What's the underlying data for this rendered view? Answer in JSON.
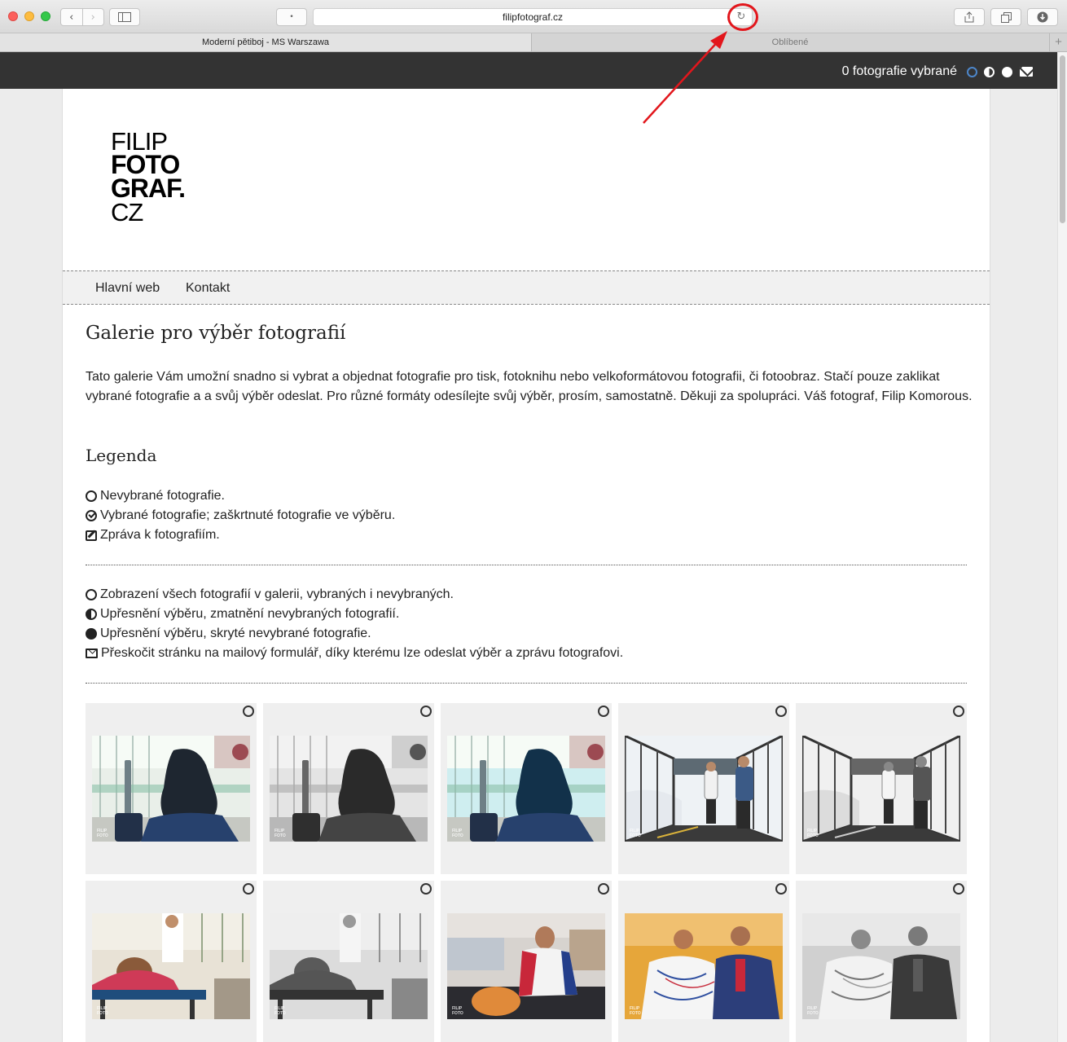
{
  "browser": {
    "url": "filipfotograf.cz",
    "tabs": [
      {
        "label": "Moderní pětiboj - MS Warszawa",
        "active": true
      },
      {
        "label": "Oblíbené",
        "active": false
      }
    ],
    "icons": [
      "back-icon",
      "forward-icon",
      "sidebar-icon",
      "reload-icon",
      "share-icon",
      "tabs-icon",
      "downloads-icon",
      "new-tab-icon"
    ]
  },
  "topbar": {
    "selected_count": "0 fotografie vybrané",
    "icons": [
      "circle-outline-icon",
      "half-circle-icon",
      "full-circle-icon",
      "envelope-icon"
    ],
    "accent_color": "#4d86c9"
  },
  "logo": {
    "line1": "FILIP",
    "line2": "FOTO",
    "line3": "GRAF.",
    "line4": "CZ"
  },
  "menu": {
    "items": [
      {
        "label": "Hlavní web"
      },
      {
        "label": "Kontakt"
      }
    ]
  },
  "content": {
    "title": "Galerie pro výběr fotografií",
    "intro": "Tato galerie Vám umožní snadno si vybrat a objednat fotografie pro tisk, fotoknihu nebo velkoformátovou fotografii, či fotoobraz. Stačí pouze zaklikat vybrané fotografie a a svůj výběr odeslat. Pro různé formáty odesílejte svůj výběr, prosím, samostatně. Děkuji za spolupráci. Váš fotograf, Filip Komorous.",
    "legend_title": "Legenda",
    "legend_items": [
      {
        "icon": "circle-outline-icon",
        "text": "Nevybrané fotografie."
      },
      {
        "icon": "check-circle-icon",
        "text": "Vybrané fotografie; zaškrtnuté fotografie ve výběru."
      },
      {
        "icon": "edit-icon",
        "text": "Zpráva k fotografiím."
      }
    ],
    "view_items": [
      {
        "icon": "circle-outline-icon",
        "text": "Zobrazení všech fotografií v galerii, vybraných i nevybraných."
      },
      {
        "icon": "half-circle-icon",
        "text": "Upřesnění výběru, zmatnění nevybraných fotografií."
      },
      {
        "icon": "full-circle-icon",
        "text": "Upřesnění výběru, skryté nevybrané fotografie."
      },
      {
        "icon": "envelope-icon",
        "text": "Přeskočit stránku na mailový formulář, díky kterému lze odeslat výběr a zprávu fotografovi."
      }
    ]
  },
  "gallery": {
    "watermark": "FILIP FOTO GRAF.",
    "photos": [
      {
        "scene": "airport-waiting-hooded",
        "style": "color"
      },
      {
        "scene": "airport-waiting-hooded",
        "style": "bw"
      },
      {
        "scene": "airport-waiting-hooded",
        "style": "cyan"
      },
      {
        "scene": "jet-bridge-two-men",
        "style": "color"
      },
      {
        "scene": "jet-bridge-two-men",
        "style": "bw"
      },
      {
        "scene": "massage-table-woman",
        "style": "color"
      },
      {
        "scene": "massage-table-woman",
        "style": "bw"
      },
      {
        "scene": "athlete-sitting-floor",
        "style": "color"
      },
      {
        "scene": "two-men-talking",
        "style": "color"
      },
      {
        "scene": "two-men-talking",
        "style": "bw"
      }
    ]
  },
  "annotation": {
    "color": "#e2161c"
  }
}
